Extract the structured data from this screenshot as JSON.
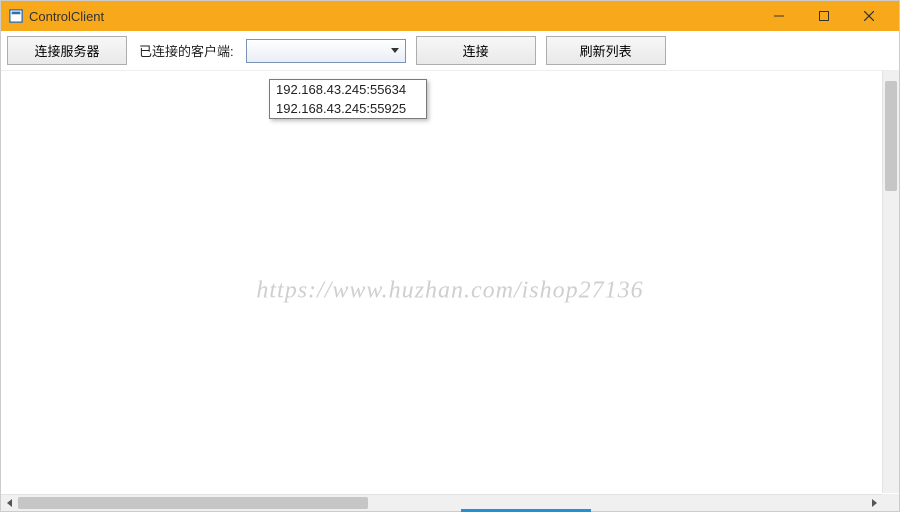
{
  "titlebar": {
    "title": "ControlClient"
  },
  "toolbar": {
    "connect_server_label": "连接服务器",
    "connected_clients_label": "已连接的客户端:",
    "combo_selected": "",
    "connect_label": "连接",
    "refresh_label": "刷新列表"
  },
  "dropdown": {
    "items": [
      {
        "text": "192.168.43.245:55634"
      },
      {
        "text": "192.168.43.245:55925"
      }
    ]
  },
  "watermark": {
    "text": "https://www.huzhan.com/ishop27136"
  }
}
